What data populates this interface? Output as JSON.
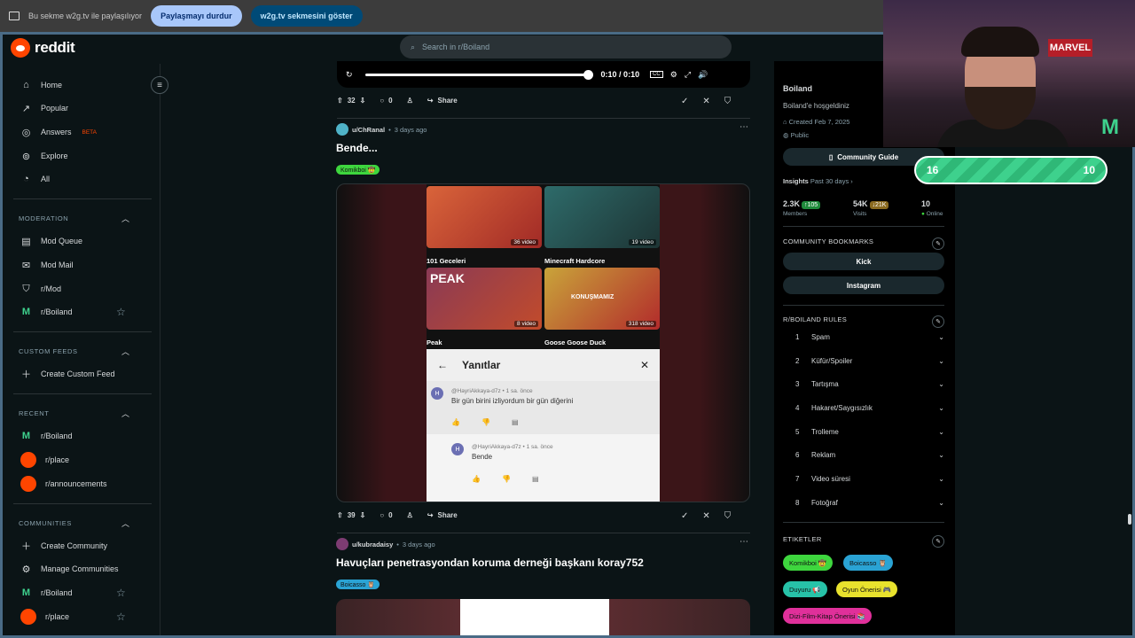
{
  "sharebar": {
    "text": "Bu sekme w2g.tv ile paylaşılıyor",
    "stop": "Paylaşmayı durdur",
    "show": "w2g.tv sekmesini göster"
  },
  "header": {
    "logo": "reddit",
    "search_placeholder": "Search in r/Boiland"
  },
  "sidebar": {
    "main": [
      {
        "label": "Home",
        "icon": "home-icon"
      },
      {
        "label": "Popular",
        "icon": "popular-icon"
      },
      {
        "label": "Answers",
        "icon": "answers-icon",
        "badge": "BETA"
      },
      {
        "label": "Explore",
        "icon": "explore-icon"
      },
      {
        "label": "All",
        "icon": "all-icon"
      }
    ],
    "moderation_title": "MODERATION",
    "moderation": [
      "Mod Queue",
      "Mod Mail",
      "r/Mod",
      "r/Boiland"
    ],
    "custom_feeds_title": "CUSTOM FEEDS",
    "create_custom_feed": "Create Custom Feed",
    "recent_title": "RECENT",
    "recent": [
      "r/Boiland",
      "r/place",
      "r/announcements"
    ],
    "communities_title": "COMMUNITIES",
    "create_community": "Create Community",
    "manage_communities": "Manage Communities",
    "communities": [
      "r/Boiland",
      "r/place"
    ]
  },
  "player": {
    "time": "0:10 / 0:10"
  },
  "post1": {
    "votes": "32",
    "comments": "0",
    "share": "Share"
  },
  "post2": {
    "author": "u/ChRanal",
    "time": "3 days ago",
    "title": "Bende...",
    "flair": "Komikboi 🤠",
    "votes": "39",
    "comments": "0",
    "share": "Share",
    "media": {
      "thumbs": [
        {
          "label": "36 video",
          "caption": "101 Geceleri"
        },
        {
          "label": "19 video",
          "caption": "Minecraft Hardcore"
        },
        {
          "label": "8 video",
          "caption": "Peak",
          "overlay": "PEAK"
        },
        {
          "label": "318 video",
          "caption": "Goose Goose Duck",
          "overlay": "KONUŞMAMIZ"
        }
      ],
      "sheet_title": "Yanıtlar",
      "comment1_user": "@HayriAkkaya-d7z • 1 sa. önce",
      "comment1_text": "Bir gün birini izliyordum bir gün diğerini",
      "comment2_user": "@HayriAkkaya-d7z • 1 sa. önce",
      "comment2_text": "Bende",
      "avatar_letter": "H"
    }
  },
  "post3": {
    "author": "u/kubradaisy",
    "time": "3 days ago",
    "title": "Havuçları penetrasyondan koruma derneği başkanı koray752",
    "flair": "Boicasso 🦉"
  },
  "right": {
    "name": "Boiland",
    "welcome": "Boiland'e hoşgeldiniz",
    "created": "Created Feb 7, 2025",
    "visibility": "Public",
    "guide": "Community Guide",
    "insights": "Insights",
    "insights_range": "Past 30 days ›",
    "members_num": "2.3K",
    "members_delta": "↑105",
    "members_lbl": "Members",
    "visits_num": "54K",
    "visits_delta": "↓21K",
    "visits_lbl": "Visits",
    "online_num": "10",
    "online_lbl": "Online",
    "bookmarks_title": "COMMUNITY BOOKMARKS",
    "bookmarks": [
      "Kick",
      "Instagram"
    ],
    "rules_title": "R/BOILAND RULES",
    "rules": [
      "Spam",
      "Küfür/Spoiler",
      "Tartışma",
      "Hakaret/Saygısızlık",
      "Trolleme",
      "Reklam",
      "Video süresi",
      "Fotoğraf"
    ],
    "tags_title": "ETIKETLER",
    "tags": [
      "Komikboi 🤠",
      "Boicasso 🦉",
      "Duyuru 📢",
      "Oyun Önerisi 🎮",
      "Dizi-Film-Kitap Önerisi 📚"
    ]
  },
  "overlay": {
    "sign": "MARVEL",
    "score_left": "16",
    "score_right": "10"
  },
  "colors": {
    "reddit": "#ff4500",
    "bg": "#0b1416",
    "score": "#3ed18d"
  }
}
